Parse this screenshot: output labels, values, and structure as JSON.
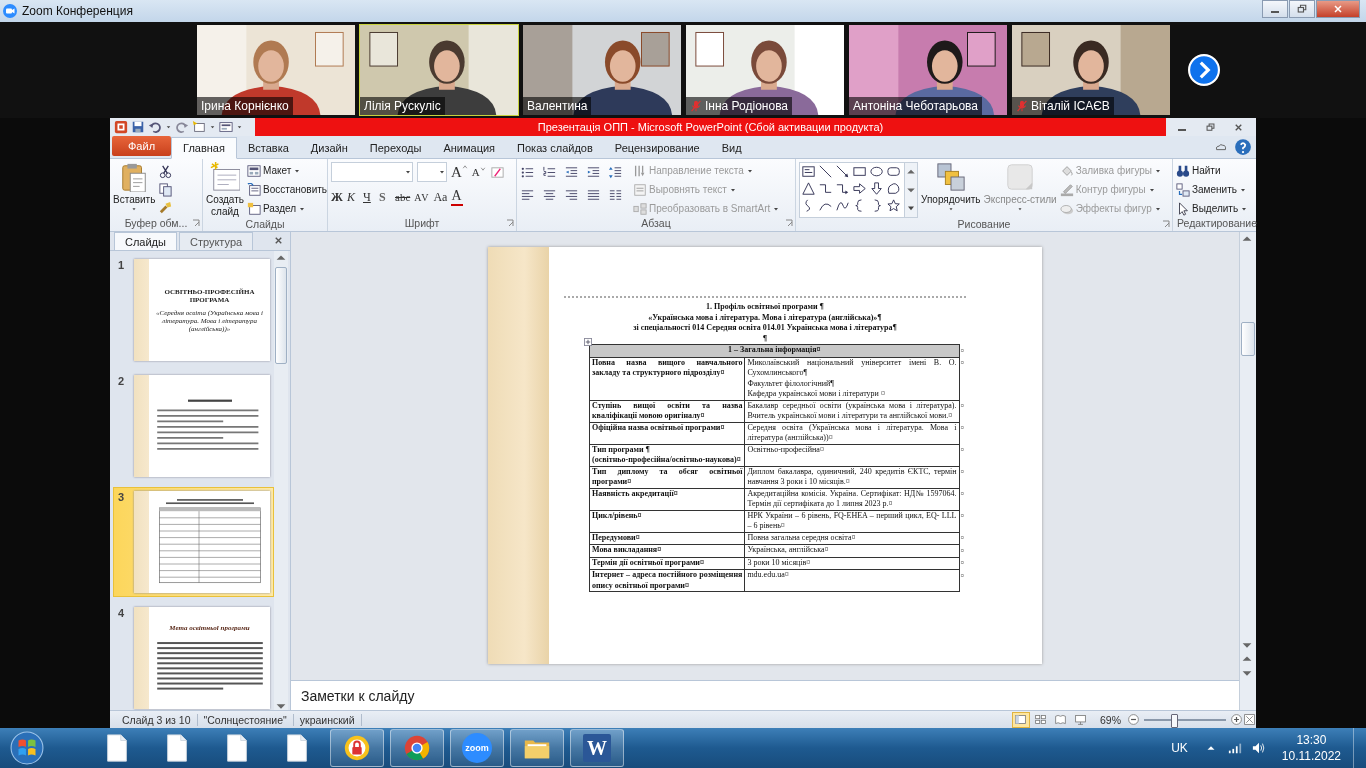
{
  "window": {
    "title": "Zoom Конференция"
  },
  "participants": [
    {
      "name": "Ірина Корнієнко",
      "muted": false,
      "speaking": false
    },
    {
      "name": "Лілія Рускуліс",
      "muted": false,
      "speaking": true
    },
    {
      "name": "Валентина",
      "muted": false,
      "speaking": false
    },
    {
      "name": "Інна Родіонова",
      "muted": true,
      "speaking": false
    },
    {
      "name": "Антоніна Чеботарьова",
      "muted": false,
      "speaking": false
    },
    {
      "name": "Віталій ІСАЄВ",
      "muted": true,
      "speaking": false
    }
  ],
  "app": {
    "title": "Презентація ОПП  -  Microsoft PowerPoint (Сбой активации продукта)"
  },
  "tabs": [
    {
      "label": "Файл",
      "kind": "file",
      "selected": false
    },
    {
      "label": "Главная",
      "kind": "tab",
      "selected": true
    },
    {
      "label": "Вставка",
      "kind": "tab",
      "selected": false
    },
    {
      "label": "Дизайн",
      "kind": "tab",
      "selected": false
    },
    {
      "label": "Переходы",
      "kind": "tab",
      "selected": false
    },
    {
      "label": "Анимация",
      "kind": "tab",
      "selected": false
    },
    {
      "label": "Показ слайдов",
      "kind": "tab",
      "selected": false
    },
    {
      "label": "Рецензирование",
      "kind": "tab",
      "selected": false
    },
    {
      "label": "Вид",
      "kind": "tab",
      "selected": false
    }
  ],
  "ribbon": {
    "clipboard": {
      "label": "Буфер обм...",
      "paste": "Вставить"
    },
    "slides": {
      "label": "Слайды",
      "new_slide": "Создать слайд",
      "commands": [
        {
          "label": "Макет",
          "dropdown": true,
          "disabled": false
        },
        {
          "label": "Восстановить",
          "dropdown": false,
          "disabled": false
        },
        {
          "label": "Раздел",
          "dropdown": true,
          "disabled": false
        }
      ]
    },
    "font": {
      "label": "Шрифт",
      "grow": "A",
      "shrink": "A",
      "styles": [
        "Ж",
        "К",
        "Ч",
        "S",
        "abc",
        "AV",
        "Aa",
        "A"
      ]
    },
    "paragraph": {
      "label": "Абзац",
      "commands": [
        {
          "label": "Направление текста",
          "dropdown": true,
          "disabled": true
        },
        {
          "label": "Выровнять текст",
          "dropdown": true,
          "disabled": true
        },
        {
          "label": "Преобразовать в SmartArt",
          "dropdown": true,
          "disabled": true
        }
      ]
    },
    "drawing": {
      "label": "Рисование",
      "arrange": "Упорядочить",
      "quick_styles": {
        "label": "Экспресс-стили",
        "disabled": true
      },
      "commands": [
        {
          "label": "Заливка фигуры",
          "dropdown": true,
          "disabled": true
        },
        {
          "label": "Контур фигуры",
          "dropdown": true,
          "disabled": true
        },
        {
          "label": "Эффекты фигур",
          "dropdown": true,
          "disabled": true
        }
      ]
    },
    "editing": {
      "label": "Редактирование",
      "commands": [
        {
          "label": "Найти",
          "dropdown": false,
          "disabled": false
        },
        {
          "label": "Заменить",
          "dropdown": true,
          "disabled": false
        },
        {
          "label": "Выделить",
          "dropdown": true,
          "disabled": false
        }
      ]
    }
  },
  "slide_pane": {
    "tabs": [
      {
        "label": "Слайды",
        "selected": true
      },
      {
        "label": "Структура",
        "selected": false
      }
    ]
  },
  "thumbnails": [
    {
      "number": "1",
      "kind": "title",
      "selected": false,
      "title": "ОСВІТНЬО-ПРОФЕСІЙНА ПРОГРАМА",
      "subtitle": "«Середня освіта (Українська мова і література. Мова і література (англійська))»"
    },
    {
      "number": "2",
      "kind": "text",
      "selected": false
    },
    {
      "number": "3",
      "kind": "table",
      "selected": true
    },
    {
      "number": "4",
      "kind": "heading",
      "selected": false,
      "title": "Мета освітньої програми"
    }
  ],
  "slide": {
    "title_lines": [
      "1. Профіль освітньої програми ¶",
      "«Українська мова і література. Мова і література (англійська)»¶",
      "зі спеціальності 014 Середня освіта 014.01 Українська мова і література¶",
      "¶"
    ],
    "table": {
      "heading": "1 – Загальна інформація¤",
      "heading_end": "¤",
      "rows": [
        {
          "label": "Повна назва вищого навчального закладу та структурного підрозділу¤",
          "value": "Миколаївський національний університет імені В. О. Сухомлинського¶\nФакультет філологічний¶\nКафедра української мови і літератури ¤",
          "end": "¤"
        },
        {
          "label": "Ступінь вищої освіти та назва кваліфікації мовою оригіналу¤",
          "value": "Бакалавр середньої освіти (українська мова і література). Вчитель української мови і літератури та англійської мови.¤",
          "end": "¤"
        },
        {
          "label": "Офіційна назва освітньої програми¤",
          "value": "Середня освіта (Українська мова і література. Мова і література (англійська))¤",
          "end": "¤"
        },
        {
          "label": "**Тип програми ¶**\n(освітньо-професійна/освітньо-наукова)¤",
          "value": "Освітньо-професійна¤",
          "end": "¤"
        },
        {
          "label": "Тип диплому та обсяг освітньої програми¤",
          "value": "Диплом бакалавра, одиничний, 240 кредитів ЄКТС, термін навчання 3 роки і 10 місяців.¤",
          "end": "¤"
        },
        {
          "label": "Наявність акредитації¤",
          "value": "Акредитаційна комісія. Україна. Сертифікат: НД№ 1597064. Термін дії сертифіката до 1 липня 2023 р.¤",
          "end": "¤"
        },
        {
          "label": "Цикл/рівень¤",
          "value": "НРК України – 6 рівень, FQ-EHEA – перший цикл, EQ- LLL – 6 рівень¤",
          "end": "¤"
        },
        {
          "label": "Передумови¤",
          "value": "Повна загальна середня освіта¤",
          "end": "¤"
        },
        {
          "label": "Мова викладання¤",
          "value": "Українська, англійська¤",
          "end": "¤"
        },
        {
          "label": "Термін дії освітньої програми¤",
          "value": "3 роки 10 місяців¤",
          "end": "¤"
        },
        {
          "label": "Інтернет – адреса постійного розміщення опису освітньої програми¤",
          "value": "mdu.edu.ua¤",
          "end": "¤"
        }
      ]
    }
  },
  "notes": {
    "placeholder": "Заметки к слайду"
  },
  "status_bar": {
    "slide": "Слайд 3 из 10",
    "theme": "\"Солнцестояние\"",
    "language": "украинский",
    "views": [
      {
        "selected": true
      },
      {
        "selected": false
      },
      {
        "selected": false
      },
      {
        "selected": false
      }
    ],
    "zoom": "69%",
    "zoom_slider": {
      "level": 0.35
    }
  },
  "taskbar": {
    "apps": [
      {
        "kind": "doc",
        "running": false
      },
      {
        "kind": "doc",
        "running": false
      },
      {
        "kind": "doc",
        "running": false
      },
      {
        "kind": "doc",
        "running": false
      },
      {
        "kind": "browser",
        "running": true
      },
      {
        "kind": "chrome",
        "running": true
      },
      {
        "kind": "zoom",
        "running": true,
        "label": "zoom"
      },
      {
        "kind": "folder",
        "running": true
      },
      {
        "kind": "word",
        "running": true,
        "label": "W"
      }
    ],
    "language": "UK",
    "time": "13:30",
    "date": "10.11.2022"
  }
}
